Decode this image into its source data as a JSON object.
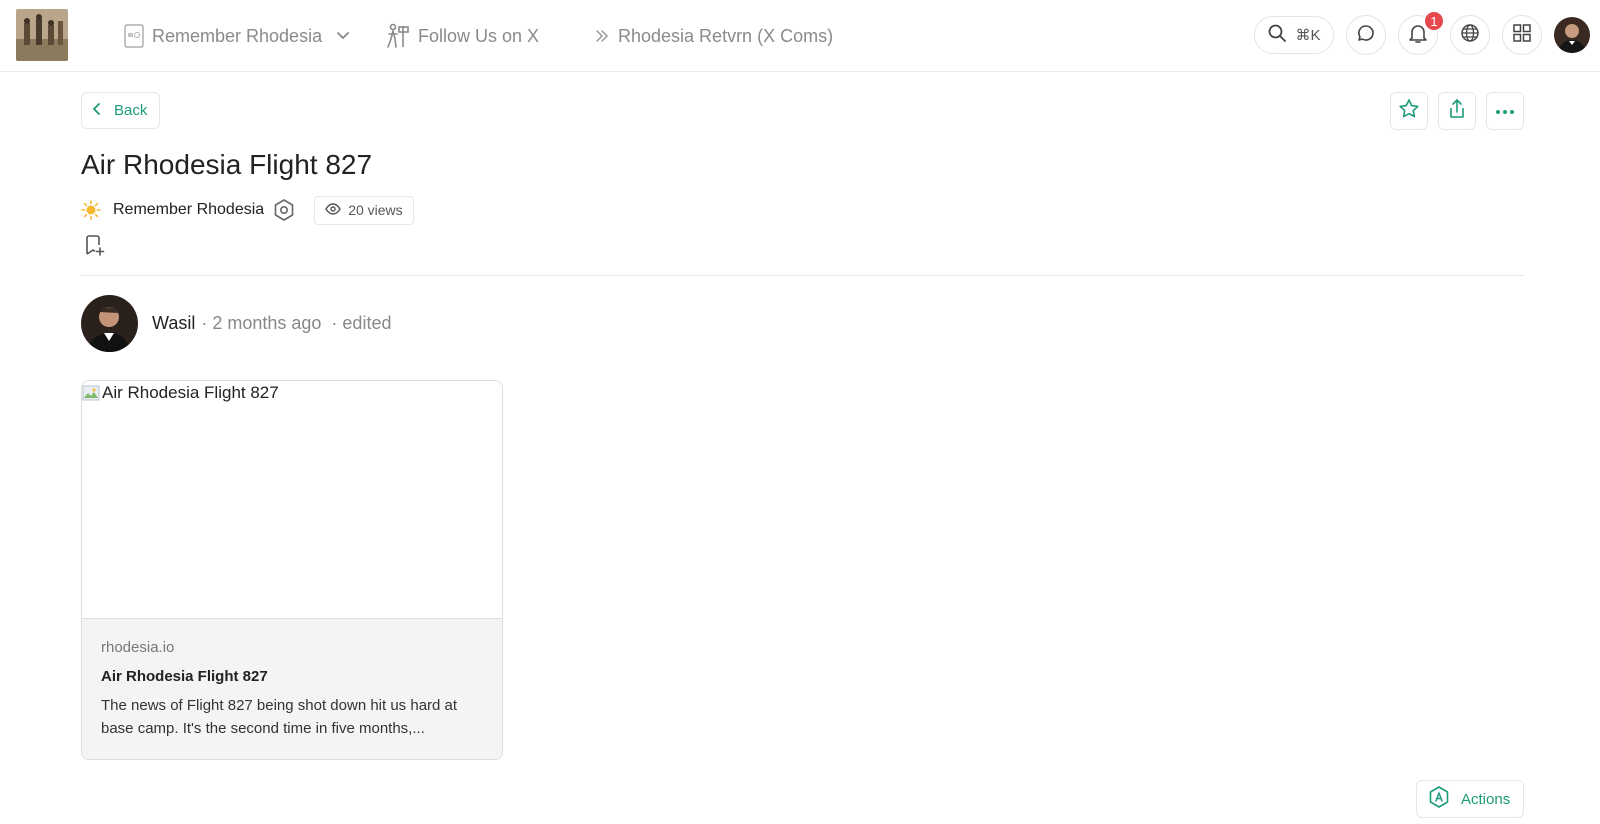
{
  "header": {
    "community_name": "Remember Rhodesia",
    "follow_label": "Follow Us on X",
    "channel_label": "Rhodesia Retvrn (X Coms)",
    "search_shortcut": "⌘K",
    "notification_count": "1"
  },
  "toolbar": {
    "back_label": "Back"
  },
  "post": {
    "title": "Air Rhodesia Flight 827",
    "community": "Remember Rhodesia",
    "views": "20 views",
    "author": "Wasil",
    "time": "· 2 months ago",
    "edited": "·  edited"
  },
  "link_card": {
    "image_alt": "Air Rhodesia Flight 827",
    "domain": "rhodesia.io",
    "title": "Air Rhodesia Flight 827",
    "description": "The news of Flight 827 being shot down hit us hard at base camp. It's the second time in five months,..."
  },
  "footer": {
    "actions_label": "Actions"
  },
  "colors": {
    "accent": "#1e9b7a",
    "badge": "#e5484d"
  }
}
